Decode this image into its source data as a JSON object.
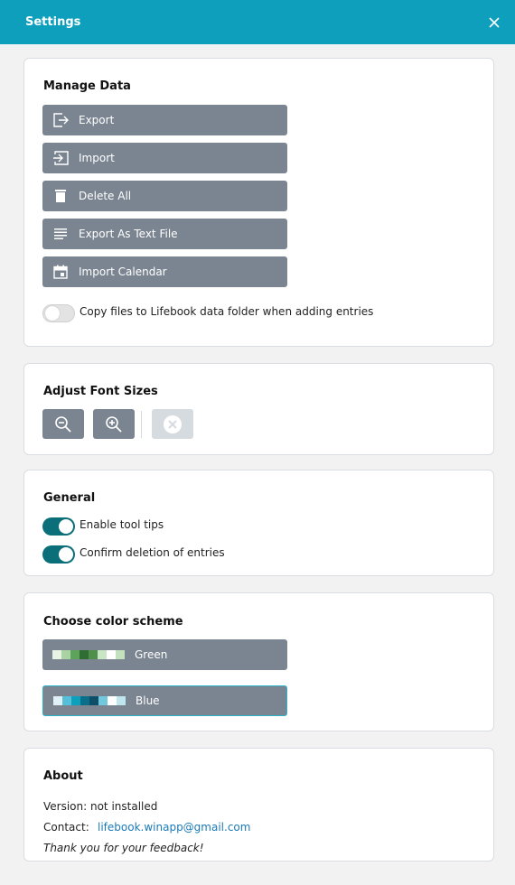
{
  "header": {
    "title": "Settings"
  },
  "manage_data": {
    "heading": "Manage Data",
    "buttons": [
      {
        "label": "Export",
        "icon": "export-icon"
      },
      {
        "label": "Import",
        "icon": "import-icon"
      },
      {
        "label": "Delete All",
        "icon": "trash-icon"
      },
      {
        "label": "Export As Text File",
        "icon": "text-lines-icon"
      },
      {
        "label": "Import Calendar",
        "icon": "calendar-icon"
      }
    ],
    "copy_toggle_label": "Copy files to Lifebook data folder when adding entries",
    "copy_toggle_on": false
  },
  "font_sizes": {
    "heading": "Adjust Font Sizes"
  },
  "general": {
    "heading": "General",
    "tooltips_label": "Enable tool tips",
    "tooltips_on": true,
    "confirm_label": "Confirm deletion of entries",
    "confirm_on": true
  },
  "color_scheme": {
    "heading": "Choose color scheme",
    "schemes": [
      {
        "name": "Green",
        "selected": false,
        "colors": [
          "#e8f3e6",
          "#a9d3a3",
          "#5ea35a",
          "#2f6d33",
          "#4e8f4b",
          "#c9e6c4",
          "#ffffff",
          "#c3e1bd"
        ]
      },
      {
        "name": "Blue",
        "selected": true,
        "colors": [
          "#dff1f6",
          "#56c0d8",
          "#0e9fbc",
          "#0b6f8a",
          "#0e4e66",
          "#71c8dc",
          "#ffffff",
          "#bfe5ef"
        ]
      }
    ]
  },
  "about": {
    "heading": "About",
    "version_text": "Version: not installed",
    "contact_label": "Contact:",
    "contact_email": "lifebook.winapp@gmail.com",
    "thanks": "Thank you for your feedback!"
  },
  "colors": {
    "header": "#0e9fbc",
    "button": "#7b8591",
    "toggle_on": "#0b6f7a",
    "selected_border": "#2bb3c9"
  }
}
